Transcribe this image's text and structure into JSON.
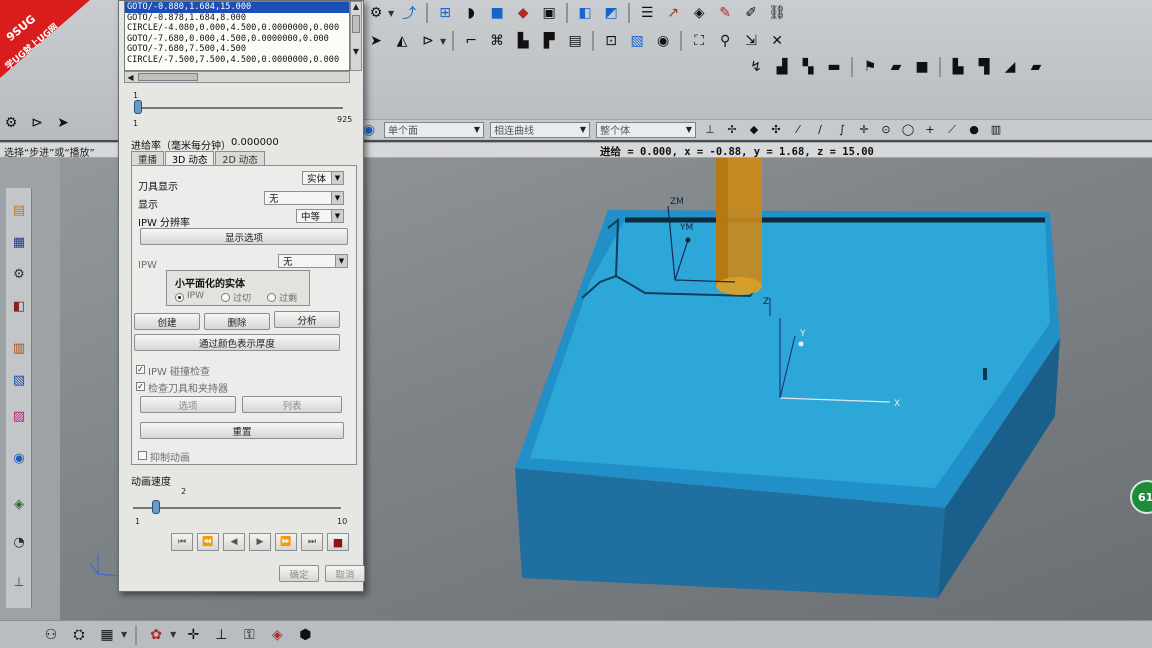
{
  "watermark": {
    "brand": "9SUG",
    "slogan": "学UG就上UG网"
  },
  "toolbar_icons": {
    "row1": [
      "tool-icon",
      "wcs-icon",
      "snap-icon",
      "shaded-icon",
      "cube-icon",
      "paint-icon",
      "color-icon",
      "section-icon",
      "analysis-icon",
      "layer-icon",
      "graph-icon",
      "mesh-icon",
      "edit-icon",
      "pen-icon",
      "link-icon"
    ],
    "row2": [
      "cursor-icon",
      "select-icon",
      "drill-icon",
      "mill-icon",
      "program-icon",
      "operation-icon",
      "view-icon",
      "output-icon",
      "toolpath-icon",
      "verify-icon",
      "machine-icon",
      "clamp-icon",
      "probe-icon",
      "translate-icon",
      "close-icon"
    ],
    "row3": [
      "arrow-icon",
      "vise-icon",
      "fixture-icon",
      "list-icon",
      "flag-icon",
      "comment-icon",
      "box-icon",
      "stock-icon",
      "tool-path-icon"
    ]
  },
  "selection_filter": {
    "options": [
      "单个面",
      "相连曲线",
      "整个体"
    ]
  },
  "status": {
    "prompt": "选择“步进”或“播放”",
    "feed_readout": "进给 = 0.000, x = -0.88, y = 1.68, z = 15.00"
  },
  "graphics_labels": {
    "zm": "ZM",
    "ym": "YM",
    "z": "Z",
    "y": "Y",
    "x": "X"
  },
  "status_badge": "61",
  "dialog": {
    "code_lines": [
      "GOTO/-0.880,1.684,15.000",
      "GOTO/-0.878,1.684,8.000",
      "CIRCLE/-4.080,0.000,4.500,0.0000000,0.000",
      "GOTO/-7.680,0.000,4.500,0.0000000,0.000",
      "GOTO/-7.680,7.500,4.500",
      "CIRCLE/-7.500,7.500,4.500,0.0000000,0.000"
    ],
    "selected_line": 0,
    "slider": {
      "min": "1",
      "max": "925",
      "value_label": "1"
    },
    "feed_label": "进给率（毫米每分钟）",
    "feed_value": "0.000000",
    "tabs": [
      "重播",
      "3D 动态",
      "2D 动态"
    ],
    "active_tab": 1,
    "tool_display_label": "刀具显示",
    "tool_display_value": "实体",
    "display_label": "显示",
    "display_value": "无",
    "ipw_resolution_label": "IPW 分辨率",
    "ipw_resolution_value": "中等",
    "display_options_button": "显示选项",
    "ipw_label": "IPW",
    "ipw_value": "无",
    "facet_group_title": "小平面化的实体",
    "facet_options": [
      "IPW",
      "过切",
      "过剩"
    ],
    "facet_selected": 0,
    "create_button": "创建",
    "delete_button": "删除",
    "analyze_button": "分析",
    "color_thickness_button": "通过颜色表示厚度",
    "ipw_collision_label": "IPW 碰撞检查",
    "check_holder_label": "检查刀具和夹持器",
    "options_button": "选项",
    "list_button": "列表",
    "reset_button": "重置",
    "suppress_animation_label": "抑制动画",
    "speed_label": "动画速度",
    "speed_value_label": "2",
    "speed_min": "1",
    "speed_max": "10",
    "speed_value": 2,
    "ok_button": "确定",
    "cancel_button": "取消"
  }
}
